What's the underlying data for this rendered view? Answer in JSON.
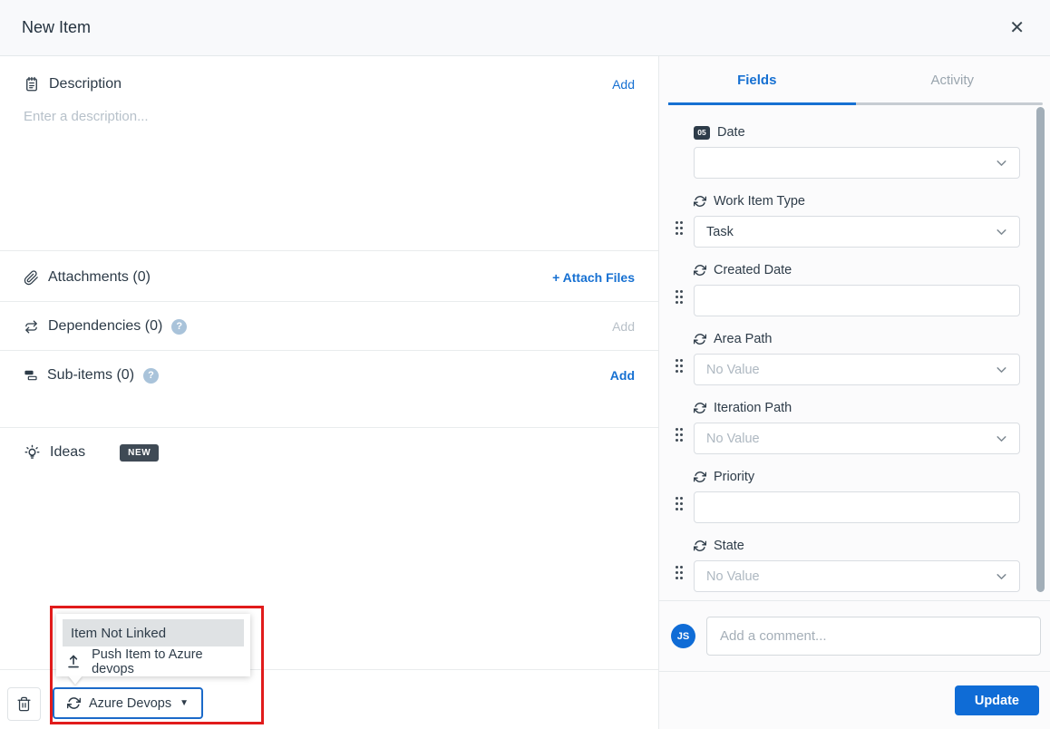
{
  "header": {
    "title": "New Item",
    "close_glyph": "✕"
  },
  "left": {
    "description": {
      "label": "Description",
      "action": "Add",
      "placeholder": "Enter a description..."
    },
    "attachments": {
      "label": "Attachments (0)",
      "action": "+ Attach Files"
    },
    "dependencies": {
      "label": "Dependencies (0)",
      "help": "?",
      "action": "Add"
    },
    "subitems": {
      "label": "Sub-items (0)",
      "help": "?",
      "action": "Add"
    },
    "ideas": {
      "label": "Ideas",
      "badge": "NEW"
    }
  },
  "integration": {
    "menu_header": "Item Not Linked",
    "menu_item": "Push Item to Azure devops",
    "button_label": "Azure Devops",
    "button_caret": "▼"
  },
  "right": {
    "tabs": [
      {
        "label": "Fields",
        "active": true
      },
      {
        "label": "Activity",
        "active": false
      }
    ],
    "fields": [
      {
        "label": "Date",
        "icon": "calendar-date-icon",
        "icon_text": "05",
        "value": "",
        "muted": false,
        "chevron": true,
        "draggable": false
      },
      {
        "label": "Work Item Type",
        "icon": "sync-icon",
        "value": "Task",
        "muted": false,
        "chevron": true,
        "draggable": true
      },
      {
        "label": "Created Date",
        "icon": "sync-icon",
        "value": "",
        "muted": false,
        "chevron": false,
        "draggable": true
      },
      {
        "label": "Area Path",
        "icon": "sync-icon",
        "value": "No Value",
        "muted": true,
        "chevron": true,
        "draggable": true
      },
      {
        "label": "Iteration Path",
        "icon": "sync-icon",
        "value": "No Value",
        "muted": true,
        "chevron": true,
        "draggable": true
      },
      {
        "label": "Priority",
        "icon": "sync-icon",
        "value": "",
        "muted": false,
        "chevron": false,
        "draggable": true
      },
      {
        "label": "State",
        "icon": "sync-icon",
        "value": "No Value",
        "muted": true,
        "chevron": true,
        "draggable": true
      }
    ],
    "comment": {
      "avatar_initials": "JS",
      "placeholder": "Add a comment..."
    },
    "update_label": "Update"
  },
  "colors": {
    "accent_blue": "#1670d2",
    "button_blue": "#0f6cd6",
    "highlight_red": "#e11b1b",
    "badge_dark": "#3f4a55",
    "avatar_blue": "#0f6cd6"
  }
}
